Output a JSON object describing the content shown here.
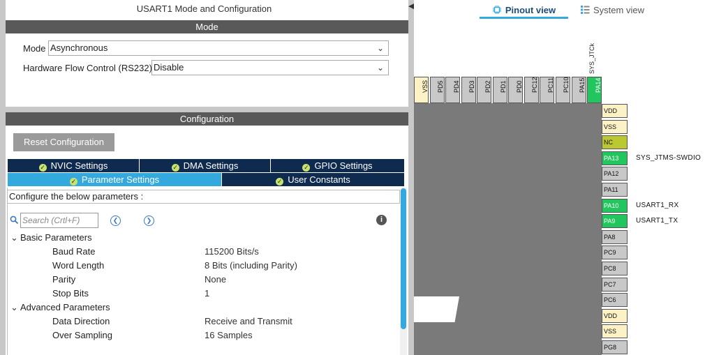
{
  "left_panel": {
    "title": "USART1 Mode and Configuration",
    "mode_section": {
      "header": "Mode",
      "mode_label": "Mode",
      "mode_value": "Asynchronous",
      "hw_flow_label": "Hardware Flow Control (RS232)",
      "hw_flow_value": "Disable"
    },
    "config_section": {
      "header": "Configuration",
      "reset_button": "Reset Configuration",
      "tabs_row1": [
        "NVIC Settings",
        "DMA Settings",
        "GPIO Settings"
      ],
      "tabs_row2": [
        "Parameter Settings",
        "User Constants"
      ],
      "active_tab": "Parameter Settings",
      "info_text": "Configure the below parameters :",
      "search_placeholder": "Search (Crtl+F)",
      "groups": [
        {
          "name": "Basic Parameters",
          "params": [
            {
              "name": "Baud Rate",
              "value": "115200 Bits/s"
            },
            {
              "name": "Word Length",
              "value": "8 Bits (including Parity)"
            },
            {
              "name": "Parity",
              "value": "None"
            },
            {
              "name": "Stop Bits",
              "value": "1"
            }
          ]
        },
        {
          "name": "Advanced Parameters",
          "params": [
            {
              "name": "Data Direction",
              "value": "Receive and Transmit"
            },
            {
              "name": "Over Sampling",
              "value": "16 Samples"
            }
          ]
        }
      ]
    }
  },
  "right_panel": {
    "tabs": {
      "pinout": "Pinout view",
      "system": "System view"
    },
    "top_pins": [
      "VSS",
      "PD5",
      "PD4",
      "PD3",
      "PD2",
      "PD1",
      "PD0",
      "PC12",
      "PC11",
      "PC10",
      "PA15",
      "PA14"
    ],
    "top_signal": "SYS_JTCk",
    "right_pins": [
      {
        "name": "VDD",
        "signal": ""
      },
      {
        "name": "VSS",
        "signal": ""
      },
      {
        "name": "NC",
        "signal": ""
      },
      {
        "name": "PA13",
        "signal": "SYS_JTMS-SWDIO"
      },
      {
        "name": "PA12",
        "signal": ""
      },
      {
        "name": "PA11",
        "signal": ""
      },
      {
        "name": "PA10",
        "signal": "USART1_RX"
      },
      {
        "name": "PA9",
        "signal": "USART1_TX"
      },
      {
        "name": "PA8",
        "signal": ""
      },
      {
        "name": "PC9",
        "signal": ""
      },
      {
        "name": "PC8",
        "signal": ""
      },
      {
        "name": "PC7",
        "signal": ""
      },
      {
        "name": "PC6",
        "signal": ""
      },
      {
        "name": "VDD",
        "signal": ""
      },
      {
        "name": "VSS",
        "signal": ""
      },
      {
        "name": "PG8",
        "signal": ""
      }
    ]
  },
  "colors": {
    "section_header": "#595959",
    "tab_dark": "#0f2a4f",
    "tab_active": "#34a9de",
    "pin_assigned": "#22c55e",
    "pin_power": "#fdf2c6",
    "pin_nc": "#bcc832",
    "pin_default": "#c8c8c8"
  },
  "icons": [
    "collapse-arrow-icon",
    "chevron-down-icon",
    "check-circle-icon",
    "search-icon",
    "prev-arrow-icon",
    "next-arrow-icon",
    "info-icon",
    "expand-caret-icon",
    "chip-icon",
    "list-icon"
  ]
}
